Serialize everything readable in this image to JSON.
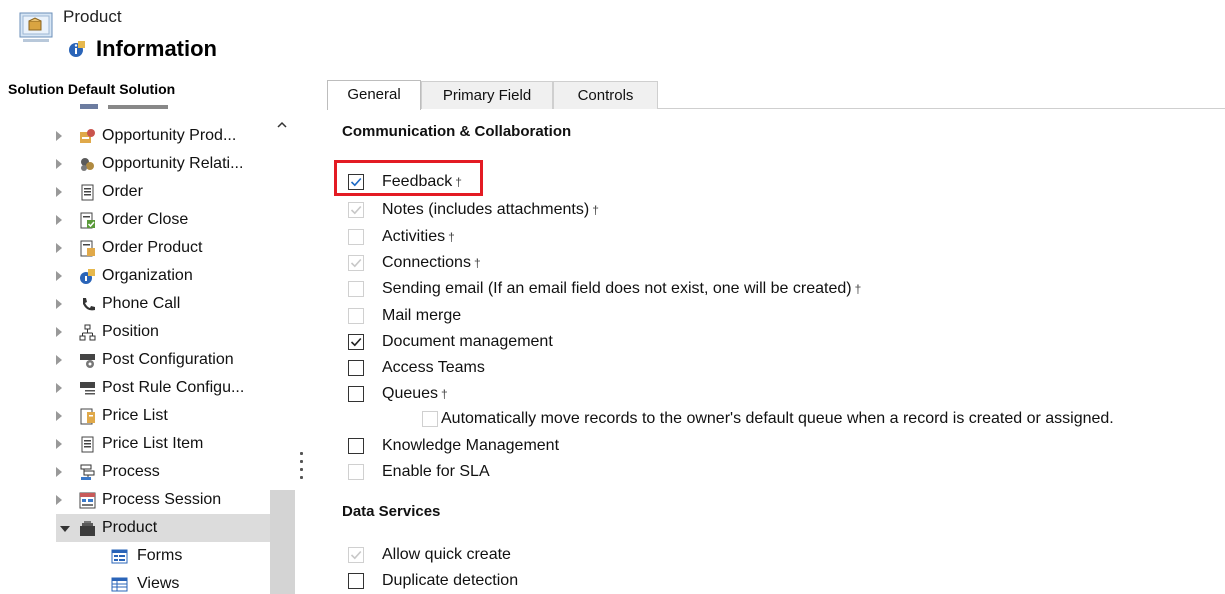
{
  "header": {
    "entity_label": "Product",
    "page_title": "Information"
  },
  "solution_label": "Solution Default Solution",
  "tree": {
    "items": [
      {
        "label": "Opportunity Prod...",
        "icon": "opportunity-product-icon"
      },
      {
        "label": "Opportunity Relati...",
        "icon": "opportunity-relationship-icon"
      },
      {
        "label": "Order",
        "icon": "order-icon"
      },
      {
        "label": "Order Close",
        "icon": "order-close-icon"
      },
      {
        "label": "Order Product",
        "icon": "order-product-icon"
      },
      {
        "label": "Organization",
        "icon": "organization-icon"
      },
      {
        "label": "Phone Call",
        "icon": "phone-icon"
      },
      {
        "label": "Position",
        "icon": "position-icon"
      },
      {
        "label": "Post Configuration",
        "icon": "post-configuration-icon"
      },
      {
        "label": "Post Rule Configu...",
        "icon": "post-rule-icon"
      },
      {
        "label": "Price List",
        "icon": "price-list-icon"
      },
      {
        "label": "Price List Item",
        "icon": "price-list-item-icon"
      },
      {
        "label": "Process",
        "icon": "process-icon"
      },
      {
        "label": "Process Session",
        "icon": "process-session-icon"
      },
      {
        "label": "Product",
        "icon": "product-icon"
      }
    ],
    "children": [
      {
        "label": "Forms",
        "icon": "forms-icon"
      },
      {
        "label": "Views",
        "icon": "views-icon"
      }
    ]
  },
  "tabs": [
    "General",
    "Primary Field",
    "Controls"
  ],
  "sections": {
    "communication": "Communication & Collaboration",
    "data_services": "Data Services"
  },
  "options": {
    "feedback": {
      "label": "Feedback",
      "checked": true,
      "disabled": false,
      "dagger": "†"
    },
    "notes": {
      "label": "Notes (includes attachments)",
      "checked": true,
      "disabled": true,
      "dagger": "†"
    },
    "activities": {
      "label": "Activities",
      "checked": false,
      "disabled": true,
      "dagger": "†"
    },
    "connections": {
      "label": "Connections",
      "checked": true,
      "disabled": true,
      "dagger": "†"
    },
    "sending_email": {
      "label": "Sending email (If an email field does not exist, one will be created)",
      "checked": false,
      "disabled": true,
      "dagger": "†"
    },
    "mail_merge": {
      "label": "Mail merge",
      "checked": false,
      "disabled": true
    },
    "document_management": {
      "label": "Document management",
      "checked": true,
      "disabled": false
    },
    "access_teams": {
      "label": "Access Teams",
      "checked": false,
      "disabled": false
    },
    "queues": {
      "label": "Queues",
      "checked": false,
      "disabled": false,
      "dagger": "†"
    },
    "auto_move": {
      "label": "Automatically move records to the owner's default queue when a record is created or assigned.",
      "checked": false,
      "disabled": true
    },
    "knowledge_management": {
      "label": "Knowledge Management",
      "checked": false,
      "disabled": false
    },
    "enable_sla": {
      "label": "Enable for SLA",
      "checked": false,
      "disabled": true
    },
    "allow_quick_create": {
      "label": "Allow quick create",
      "checked": true,
      "disabled": true
    },
    "duplicate_detection": {
      "label": "Duplicate detection",
      "checked": false,
      "disabled": false
    }
  },
  "colors": {
    "highlight": "#e31b23",
    "check_enabled": "#1e6ac5",
    "check_disabled": "#c8c8c8",
    "selected_row": "#dcdcdc"
  }
}
